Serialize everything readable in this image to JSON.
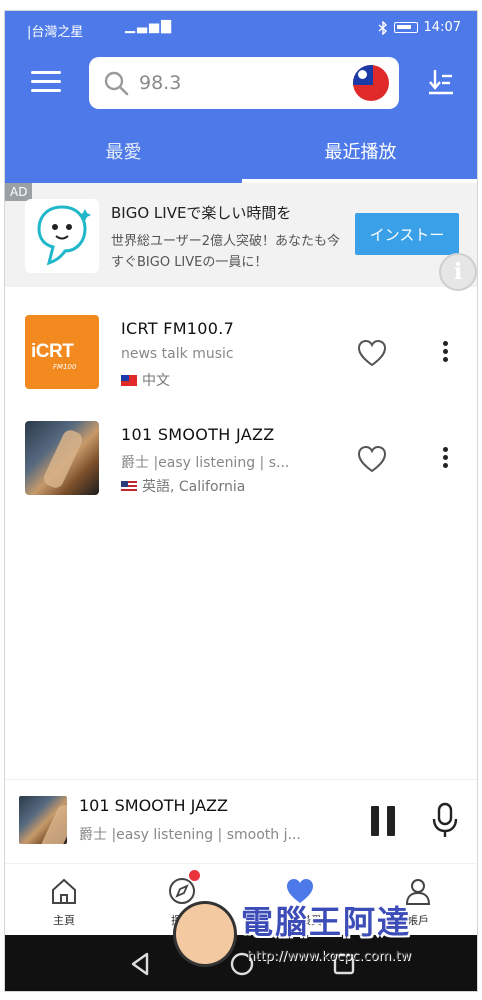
{
  "status_bar": {
    "carrier": "|台灣之星",
    "signal": "▁▃▅▇",
    "time": "14:07"
  },
  "search": {
    "placeholder": "98.3",
    "value": ""
  },
  "tabs": [
    {
      "label": "最愛"
    },
    {
      "label": "最近播放"
    }
  ],
  "ad": {
    "tag": "AD",
    "title": "BIGO LIVEで楽しい時間を",
    "description": "世界総ユーザー2億人突破！あなたも今すぐBIGO LIVEの一員に！",
    "button_label": "インストー",
    "info_glyph": "i"
  },
  "stations": [
    {
      "name": "ICRT FM100.7",
      "genre": "news talk music",
      "language": "中文",
      "logo_text": "iCRT",
      "logo_sub": "FM100",
      "flag": "taiwan"
    },
    {
      "name": "101 SMOOTH JAZZ",
      "genre": "爵士 |easy listening | s...",
      "language": "英語, California",
      "flag": "usa"
    }
  ],
  "player": {
    "name": "101 SMOOTH JAZZ",
    "genre": "爵士 |easy listening | smooth j..."
  },
  "bottom_nav": [
    {
      "label": "主頁",
      "icon": "home-icon"
    },
    {
      "label": "探索",
      "icon": "compass-icon"
    },
    {
      "label": "我的最愛",
      "icon": "heart-icon"
    },
    {
      "label": "帳戶",
      "icon": "user-icon"
    }
  ],
  "watermark": {
    "title": "電腦王阿達",
    "url": "http://www.kocpc.com.tw"
  },
  "colors": {
    "header": "#4d7ae8",
    "ad_button": "#3aa0e8",
    "accent_heart": "#4d7ae8"
  }
}
